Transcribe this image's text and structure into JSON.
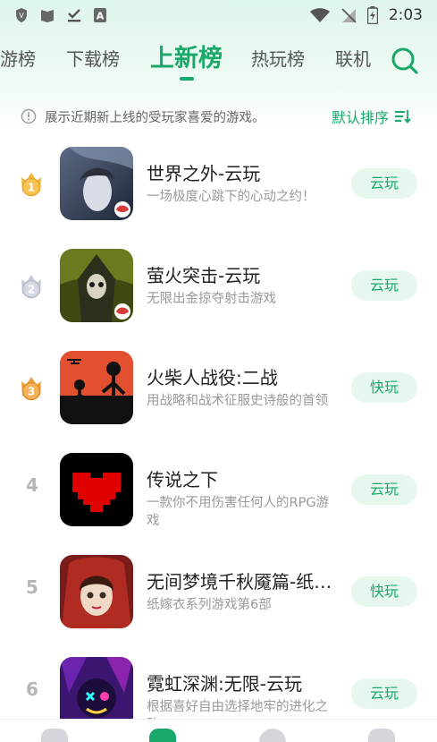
{
  "status_bar": {
    "time": "2:03",
    "left_icons": [
      "shield-icon",
      "book-icon",
      "download-check-icon",
      "a-letter-icon"
    ],
    "right_icons": [
      "wifi-icon",
      "no-signal-icon",
      "battery-charging-icon"
    ]
  },
  "tabs": [
    {
      "label": "游榜"
    },
    {
      "label": "下载榜"
    },
    {
      "label": "上新榜",
      "active": true
    },
    {
      "label": "热玩榜"
    },
    {
      "label": "联机"
    }
  ],
  "info": {
    "text": "展示近期新上线的受玩家喜爱的游戏。",
    "sort_label": "默认排序"
  },
  "colors": {
    "accent": "#1aa86a",
    "button_bg": "#e6f7ee",
    "rank_gold": "#f2b43a",
    "rank_silver": "#c7cbd6",
    "rank_bronze": "#f0a03a"
  },
  "apps": [
    {
      "rank": "1",
      "title": "世界之外-云玩",
      "desc": "一场极度心跳下的心动之约！",
      "action": "云玩"
    },
    {
      "rank": "2",
      "title": "萤火突击-云玩",
      "desc": "无限出金掠夺射击游戏",
      "action": "云玩"
    },
    {
      "rank": "3",
      "title": "火柴人战役:二战",
      "desc": "用战略和战术征服史诗般的首领",
      "action": "快玩"
    },
    {
      "rank": "4",
      "title": "传说之下",
      "desc": "一款你不用伤害任何人的RPG游戏",
      "action": "云玩"
    },
    {
      "rank": "5",
      "title": "无间梦境千秋魇篇-纸嫁衣",
      "desc": "纸嫁衣系列游戏第6部",
      "action": "快玩"
    },
    {
      "rank": "6",
      "title": "霓虹深渊:无限-云玩",
      "desc": "根据喜好自由选择地牢的进化之路~",
      "action": "云玩"
    }
  ]
}
